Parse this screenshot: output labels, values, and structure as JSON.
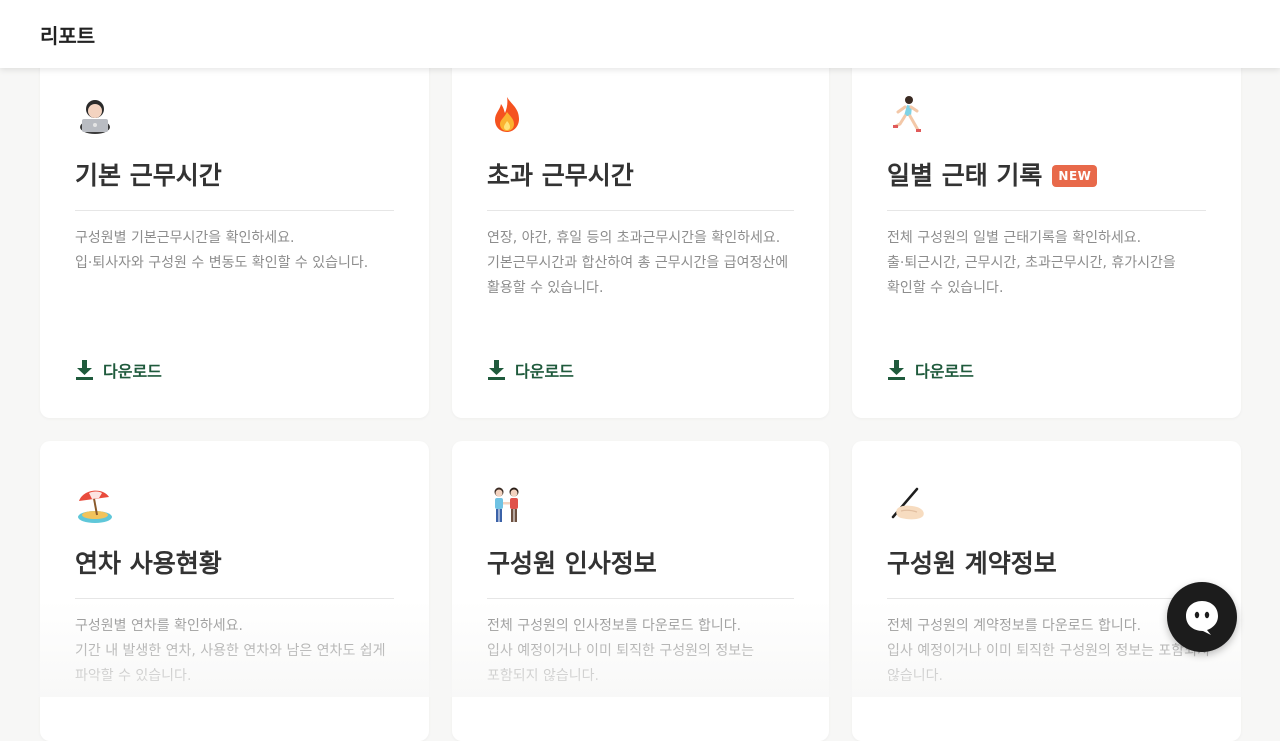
{
  "header": {
    "title": "리포트"
  },
  "cards": [
    {
      "emoji": "technologist-icon",
      "title": "기본 근무시간",
      "desc": [
        "구성원별 기본근무시간을 확인하세요.",
        "입·퇴사자와 구성원 수 변동도 확인할 수 있습니다."
      ],
      "download": "다운로드"
    },
    {
      "emoji": "fire-icon",
      "title": "초과 근무시간",
      "desc": [
        "연장, 야간, 휴일 등의 초과근무시간을 확인하세요.",
        "기본근무시간과 합산하여 총 근무시간을 급여정산에",
        "활용할 수 있습니다."
      ],
      "download": "다운로드"
    },
    {
      "emoji": "runner-icon",
      "title": "일별 근태 기록",
      "badge": "NEW",
      "desc": [
        "전체 구성원의 일별 근태기록을 확인하세요.",
        "출·퇴근시간, 근무시간, 초과근무시간, 휴가시간을",
        "확인할 수 있습니다."
      ],
      "download": "다운로드"
    },
    {
      "emoji": "beach-umbrella-icon",
      "title": "연차 사용현황",
      "desc": [
        "구성원별 연차를 확인하세요.",
        "기간 내 발생한 연차, 사용한 연차와 남은 연차도 쉽게",
        "파악할 수 있습니다."
      ]
    },
    {
      "emoji": "couple-icon",
      "title": "구성원 인사정보",
      "desc": [
        "전체 구성원의 인사정보를 다운로드 합니다.",
        "입사 예정이거나 이미 퇴직한 구성원의 정보는",
        "포함되지 않습니다."
      ]
    },
    {
      "emoji": "writing-hand-icon",
      "title": "구성원 계약정보",
      "desc": [
        "전체 구성원의 계약정보를 다운로드 합니다.",
        "입사 예정이거나 이미 퇴직한 구성원의 정보는 포함되지",
        "않습니다."
      ]
    }
  ],
  "colors": {
    "accent_green": "#1f5a3c",
    "badge": "#e8694a"
  }
}
